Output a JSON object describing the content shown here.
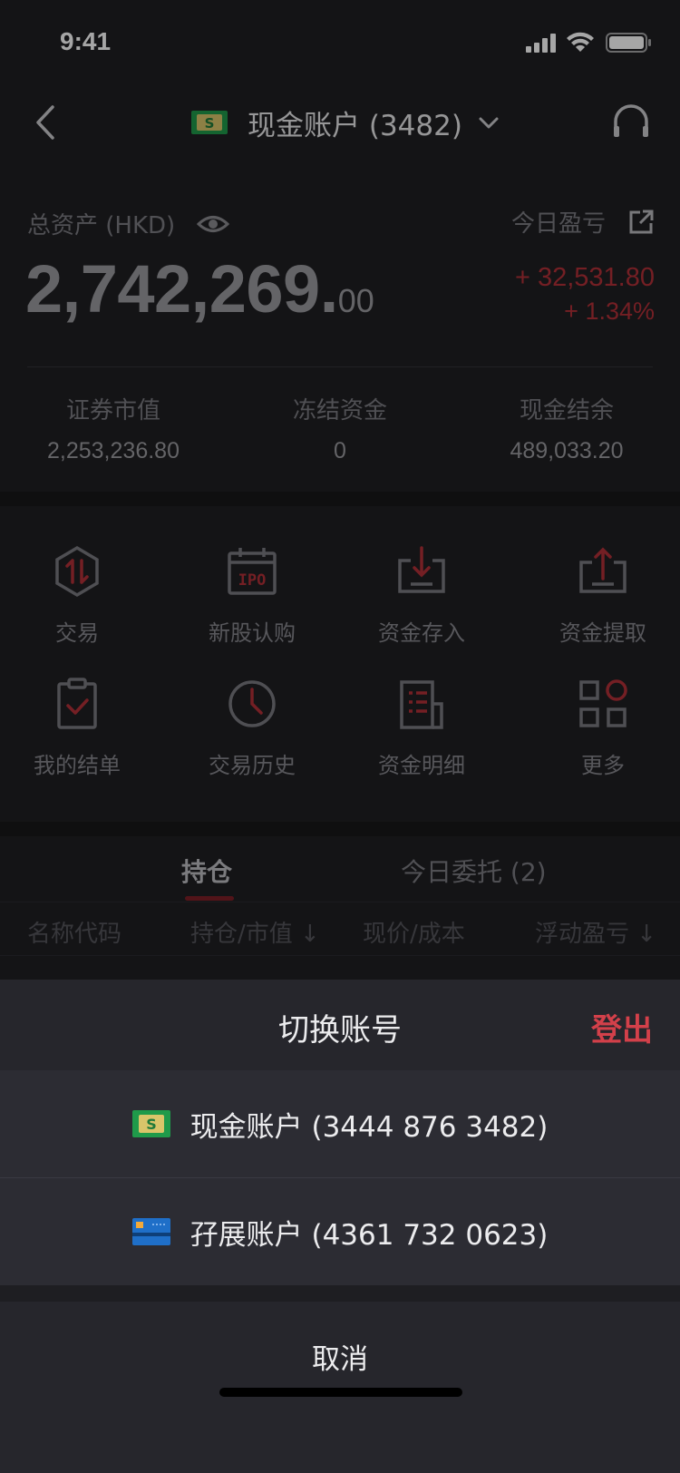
{
  "status_bar": {
    "time": "9:41"
  },
  "nav": {
    "account_title": "现金账户 (3482)"
  },
  "assets": {
    "total_label": "总资产 (HKD)",
    "today_pl_label": "今日盈亏",
    "total_int": "2,742,269.",
    "total_dec": "00",
    "pl_amount": "+ 32,531.80",
    "pl_percent": "+ 1.34%",
    "stats": [
      {
        "label": "证券市值",
        "value": "2,253,236.80"
      },
      {
        "label": "冻结资金",
        "value": "0"
      },
      {
        "label": "现金结余",
        "value": "489,033.20"
      }
    ]
  },
  "menu": [
    {
      "label": "交易",
      "icon": "trade-icon"
    },
    {
      "label": "新股认购",
      "icon": "ipo-icon"
    },
    {
      "label": "资金存入",
      "icon": "deposit-icon"
    },
    {
      "label": "资金提取",
      "icon": "withdraw-icon"
    },
    {
      "label": "我的结单",
      "icon": "statement-icon"
    },
    {
      "label": "交易历史",
      "icon": "history-icon"
    },
    {
      "label": "资金明细",
      "icon": "funds-detail-icon"
    },
    {
      "label": "更多",
      "icon": "more-icon"
    }
  ],
  "tabs": {
    "holdings": "持仓",
    "orders": "今日委托 (2)"
  },
  "columns": [
    "名称代码",
    "持仓/市值",
    "现价/成本",
    "浮动盈亏"
  ],
  "sheet": {
    "title": "切换账号",
    "logout": "登出",
    "accounts": [
      {
        "label": "现金账户 (3444 876 3482)",
        "icon": "cash-account-icon"
      },
      {
        "label": "孖展账户 (4361 732 0623)",
        "icon": "margin-card-icon"
      }
    ],
    "cancel": "取消"
  },
  "colors": {
    "accent_red": "#b23038",
    "logout_red": "#d3404a",
    "cash_green": "#1f9a4a",
    "card_blue": "#1f6fc8"
  }
}
